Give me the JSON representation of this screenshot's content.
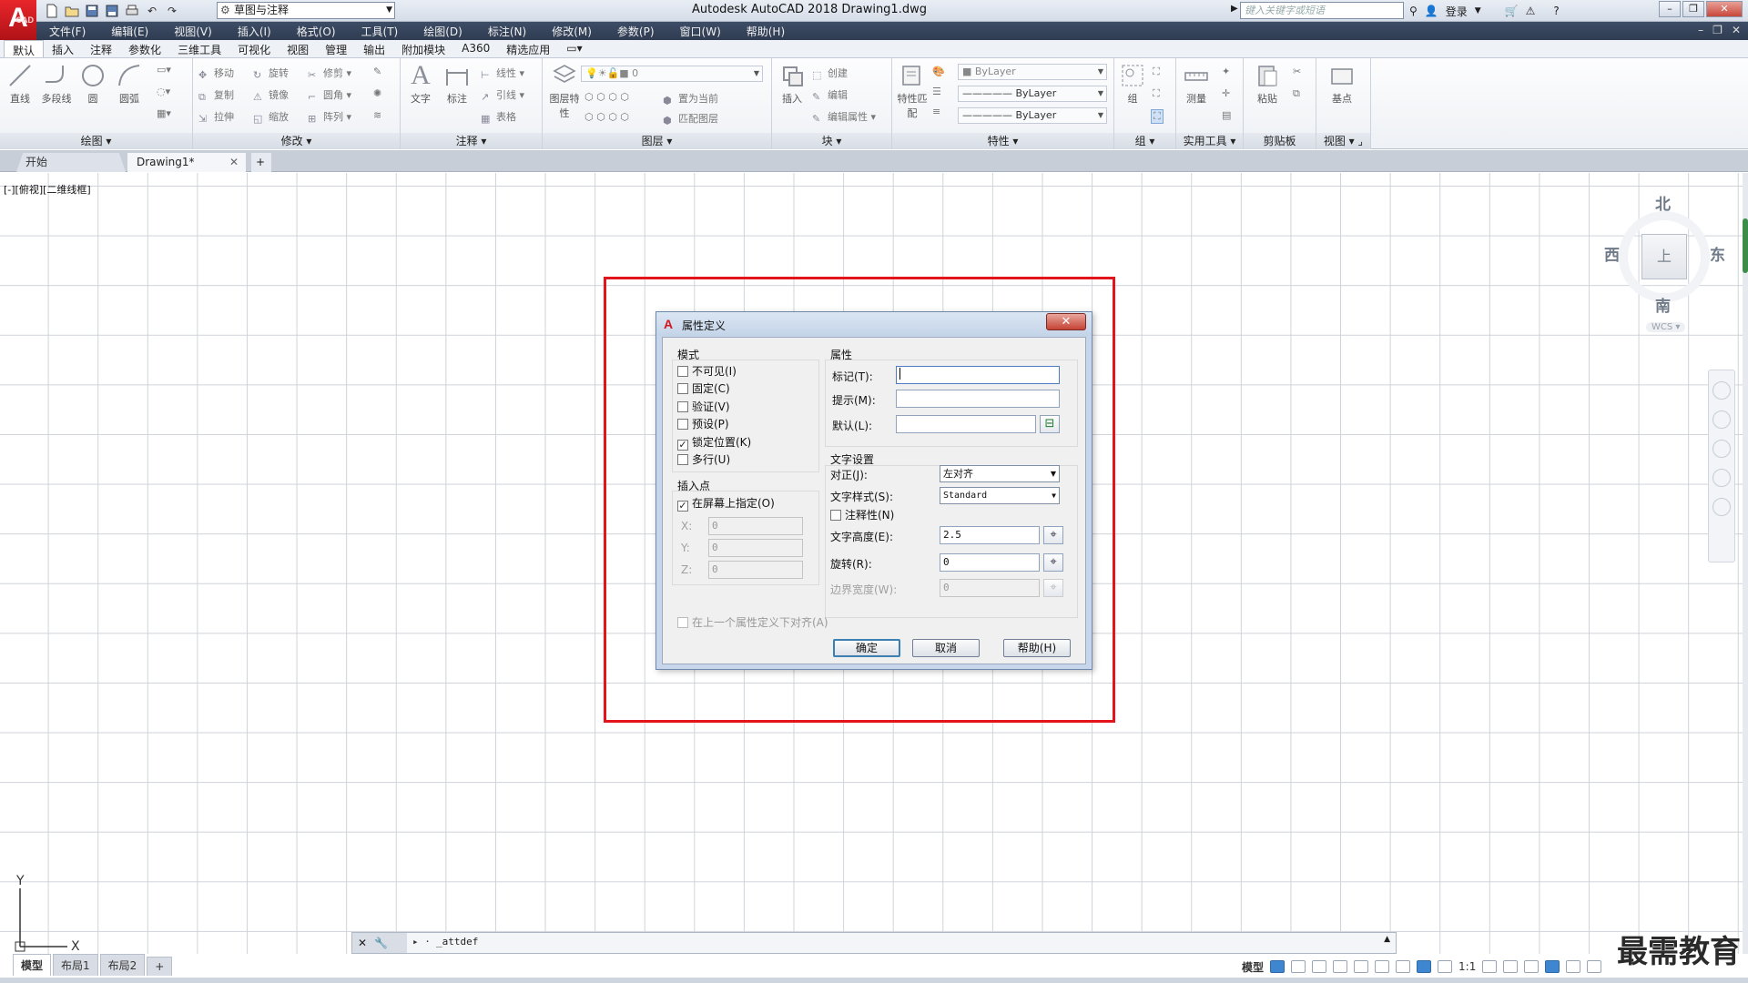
{
  "titlebar": {
    "app_logo": "A",
    "app_logo_suffix": "CAD",
    "workspace": "草图与注释",
    "window_title": "Autodesk AutoCAD 2018    Drawing1.dwg",
    "search_placeholder": "键入关键字或短语",
    "login": "登录"
  },
  "menubar": {
    "items": [
      "文件(F)",
      "编辑(E)",
      "视图(V)",
      "插入(I)",
      "格式(O)",
      "工具(T)",
      "绘图(D)",
      "标注(N)",
      "修改(M)",
      "参数(P)",
      "窗口(W)",
      "帮助(H)"
    ]
  },
  "ribbon": {
    "tabs": [
      "默认",
      "插入",
      "注释",
      "参数化",
      "三维工具",
      "可视化",
      "视图",
      "管理",
      "输出",
      "附加模块",
      "A360",
      "精选应用"
    ],
    "active_tab": 0,
    "draw": {
      "title": "绘图",
      "tools": [
        "直线",
        "多段线",
        "圆",
        "圆弧"
      ]
    },
    "modify": {
      "title": "修改",
      "tools": [
        "移动",
        "旋转",
        "修剪",
        "复制",
        "镜像",
        "圆角",
        "拉伸",
        "缩放",
        "阵列"
      ]
    },
    "annotation": {
      "title": "注释",
      "tools": [
        "文字",
        "标注",
        "线性",
        "引线",
        "表格"
      ]
    },
    "layers": {
      "title": "图层",
      "tools": [
        "图层特性",
        "置为当前",
        "匹配图层"
      ],
      "current_layer": "0"
    },
    "block": {
      "title": "块",
      "tools": [
        "插入",
        "创建",
        "编辑",
        "编辑属性"
      ]
    },
    "properties": {
      "title": "特性",
      "match": "特性匹配",
      "color": "ByLayer",
      "linetype": "ByLayer",
      "lineweight": "ByLayer"
    },
    "groups": {
      "title": "组",
      "tool": "组"
    },
    "utilities": {
      "title": "实用工具",
      "tool": "测量"
    },
    "clipboard": {
      "title": "剪贴板",
      "tool": "粘贴"
    },
    "view": {
      "title": "视图",
      "tool": "基点"
    }
  },
  "doc_tabs": {
    "start": "开始",
    "drawing": "Drawing1*"
  },
  "canvas": {
    "viewport_label": "[-][俯视][二维线框]",
    "viewcube": {
      "north": "北",
      "south": "南",
      "east": "东",
      "west": "西",
      "face": "上",
      "wcs": "WCS"
    },
    "ucs": {
      "x": "X",
      "y": "Y"
    }
  },
  "dialog": {
    "title": "属性定义",
    "close": "✕",
    "mode": {
      "title": "模式",
      "options": [
        {
          "label": "不可见(I)",
          "checked": false
        },
        {
          "label": "固定(C)",
          "checked": false
        },
        {
          "label": "验证(V)",
          "checked": false
        },
        {
          "label": "预设(P)",
          "checked": false
        },
        {
          "label": "锁定位置(K)",
          "checked": true
        },
        {
          "label": "多行(U)",
          "checked": false
        }
      ]
    },
    "insertion": {
      "title": "插入点",
      "on_screen": "在屏幕上指定(O)",
      "on_screen_checked": true,
      "x_label": "X:",
      "x_value": "0",
      "y_label": "Y:",
      "y_value": "0",
      "z_label": "Z:",
      "z_value": "0"
    },
    "attribute": {
      "title": "属性",
      "tag_label": "标记(T):",
      "tag_value": "",
      "prompt_label": "提示(M):",
      "prompt_value": "",
      "default_label": "默认(L):",
      "default_value": ""
    },
    "text_settings": {
      "title": "文字设置",
      "justify_label": "对正(J):",
      "justify_value": "左对齐",
      "style_label": "文字样式(S):",
      "style_value": "Standard",
      "annotative_label": "注释性(N)",
      "annotative_checked": false,
      "height_label": "文字高度(E):",
      "height_value": "2.5",
      "rotation_label": "旋转(R):",
      "rotation_value": "0",
      "boundary_label": "边界宽度(W):",
      "boundary_value": "0"
    },
    "align_below": "在上一个属性定义下对齐(A)",
    "ok": "确定",
    "cancel": "取消",
    "help": "帮助(H)"
  },
  "command_line": {
    "prompt": "_attdef"
  },
  "layout_tabs": [
    "模型",
    "布局1",
    "布局2"
  ],
  "statusbar": {
    "model": "模型",
    "scale": "1:1"
  },
  "watermark": "最需教育",
  "colors": {
    "highlight": "#e4141b",
    "menubar": "#2f3c52",
    "autocad_red": "#d3161c"
  }
}
